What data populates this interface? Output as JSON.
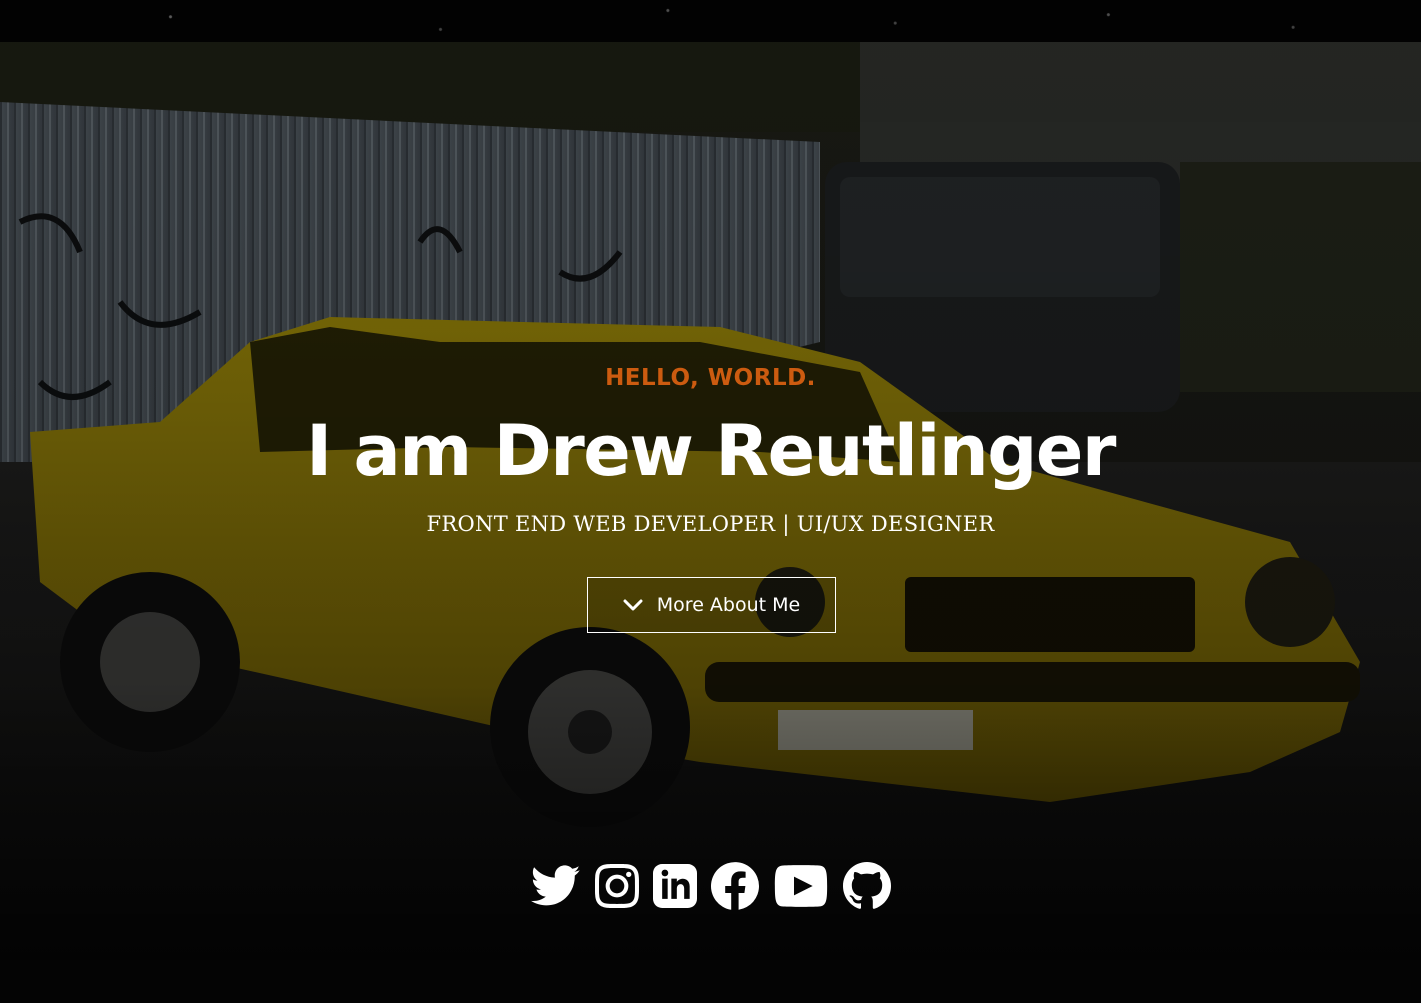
{
  "hero": {
    "greeting": "HELLO, WORLD.",
    "name": "I am Drew Reutlinger",
    "subtitle": "FRONT END WEB DEVELOPER | UI/UX DESIGNER",
    "more_button_label": "More About Me",
    "more_button_icon": "chevron-down-icon"
  },
  "social": [
    {
      "name": "twitter",
      "icon": "twitter-icon"
    },
    {
      "name": "instagram",
      "icon": "instagram-icon"
    },
    {
      "name": "linkedin",
      "icon": "linkedin-icon"
    },
    {
      "name": "facebook",
      "icon": "facebook-icon"
    },
    {
      "name": "youtube",
      "icon": "youtube-icon"
    },
    {
      "name": "github",
      "icon": "github-icon"
    }
  ],
  "colors": {
    "accent": "#cc5b10",
    "text": "#ffffff",
    "background": "#000000",
    "car": "#c9a800"
  }
}
